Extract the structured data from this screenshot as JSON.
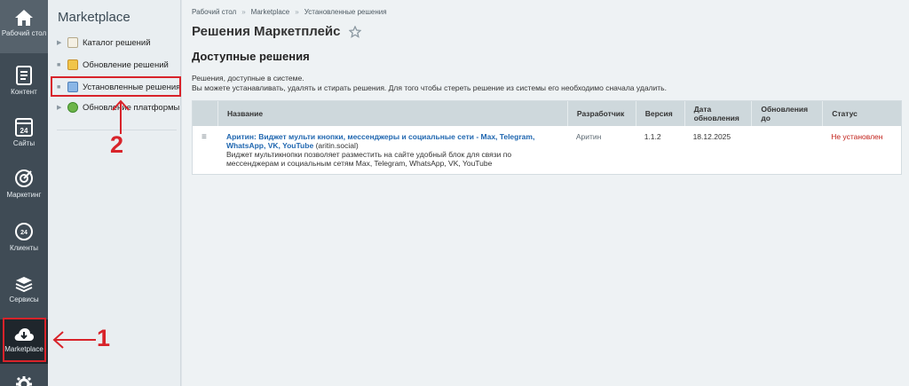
{
  "rail": {
    "items": [
      {
        "label": "Рабочий стол",
        "icon": "home-icon"
      },
      {
        "label": "Контент",
        "icon": "document-icon"
      },
      {
        "label": "Сайты",
        "icon": "calendar-icon"
      },
      {
        "label": "Маркетинг",
        "icon": "target-icon"
      },
      {
        "label": "Клиенты",
        "icon": "clients-icon"
      },
      {
        "label": "Сервисы",
        "icon": "layers-icon"
      },
      {
        "label": "Marketplace",
        "icon": "cloud-download-icon"
      }
    ]
  },
  "submenu": {
    "title": "Marketplace",
    "items": [
      {
        "label": "Каталог решений",
        "icon": "catalog-icon"
      },
      {
        "label": "Обновление решений",
        "icon": "update-icon"
      },
      {
        "label": "Установленные решения",
        "icon": "installed-icon"
      },
      {
        "label": "Обновление платформы",
        "icon": "platform-update-icon"
      }
    ]
  },
  "breadcrumb": [
    "Рабочий стол",
    "Marketplace",
    "Установленные решения"
  ],
  "page": {
    "title": "Решения Маркетплейс",
    "section_title": "Доступные решения",
    "intro_line1": "Решения, доступные в системе.",
    "intro_line2": "Вы можете устанавливать, удалять и стирать решения. Для того чтобы стереть решение из системы его необходимо сначала удалить."
  },
  "table": {
    "headers": {
      "name": "Название",
      "developer": "Разработчик",
      "version": "Версия",
      "date_line1": "Дата",
      "date_line2": "обновления",
      "updates_line1": "Обновления",
      "updates_line2": "до",
      "status": "Статус"
    },
    "rows": [
      {
        "title_line1": "Аритин: Виджет мульти кнопки, мессенджеры и социальные сети - Max, Telegram,",
        "title_line2": "WhatsApp, VK, YouTube",
        "code": "(aritin.social)",
        "desc_line1": "Виджет мультикнопки позволяет разместить на сайте удобный блок для связи по",
        "desc_line2": "мессенджерам и социальным сетям Max, Telegram, WhatsApp, VK, YouTube",
        "developer": "Аритин",
        "version": "1.1.2",
        "date": "18.12.2025",
        "updates_until": "",
        "status": "Не установлен"
      }
    ]
  },
  "annotations": {
    "marker1": "1",
    "marker2": "2",
    "color": "#d8232a"
  }
}
